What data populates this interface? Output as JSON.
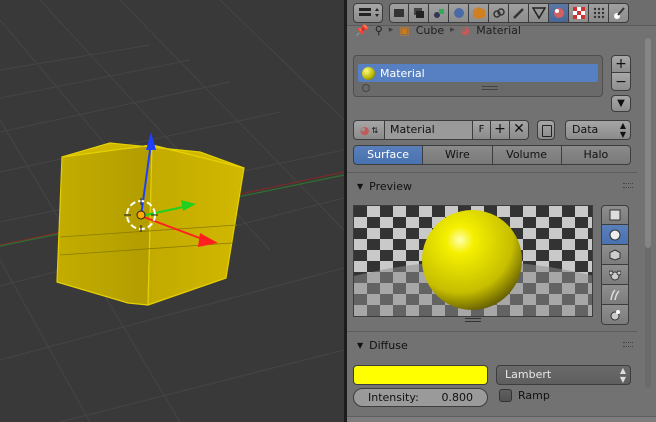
{
  "breadcrumb": {
    "object": "Cube",
    "material": "Material"
  },
  "material_slots": [
    {
      "label": "Material",
      "color": "#c8c400"
    }
  ],
  "id_block": {
    "name": "Material",
    "fake_user": "F",
    "link": "Data"
  },
  "type_tabs": [
    {
      "label": "Surface",
      "active": true
    },
    {
      "label": "Wire",
      "active": false
    },
    {
      "label": "Volume",
      "active": false
    },
    {
      "label": "Halo",
      "active": false
    }
  ],
  "panels": {
    "preview": {
      "title": "Preview"
    },
    "diffuse": {
      "title": "Diffuse",
      "color": "#ffff00",
      "shader": "Lambert",
      "intensity_label": "Intensity:",
      "intensity_value": "0.800",
      "ramp_label": "Ramp"
    }
  },
  "colors": {
    "accent": "#5680c2",
    "object": "#c8b400",
    "panel": "#727272",
    "viewport": "#393939"
  },
  "icons": [
    "editor-type-icon",
    "render-icon",
    "render-layers-icon",
    "scene-icon",
    "world-icon",
    "object-icon",
    "constraints-icon",
    "modifiers-icon",
    "data-icon",
    "material-icon",
    "texture-icon",
    "particles-icon",
    "physics-icon"
  ]
}
